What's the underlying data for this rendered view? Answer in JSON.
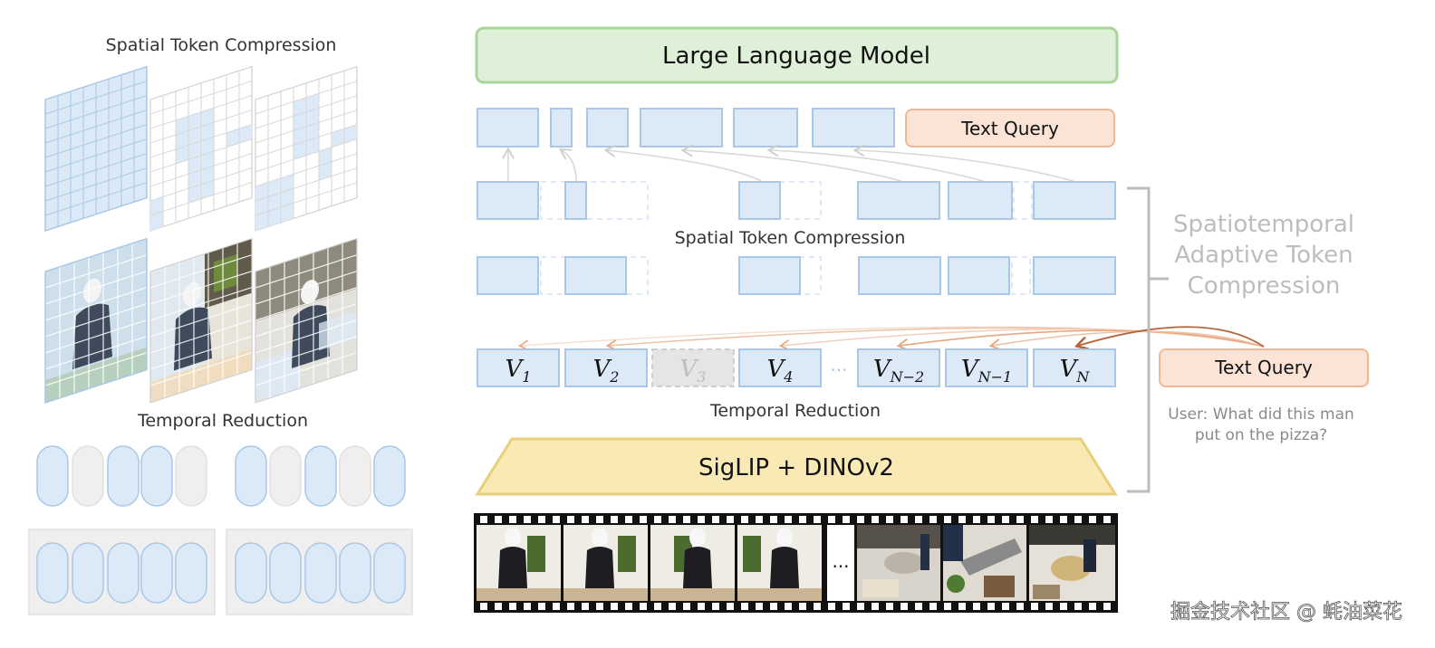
{
  "left_panel": {
    "spatial_title": "Spatial Token Compression",
    "temporal_title": "Temporal Reduction"
  },
  "main": {
    "llm_label": "Large Language Model",
    "text_query_top": "Text Query",
    "spatial_label": "Spatial Token Compression",
    "temporal_label": "Temporal Reduction",
    "encoder_label": "SigLIP + DINOv2",
    "frame_ellipsis": "...",
    "frame_tokens": [
      {
        "base": "V",
        "sub": "1"
      },
      {
        "base": "V",
        "sub": "2"
      },
      {
        "base": "V",
        "sub": "3"
      },
      {
        "base": "V",
        "sub": "4"
      },
      {
        "base": "V",
        "sub": "N−2"
      },
      {
        "base": "V",
        "sub": "N−1"
      },
      {
        "base": "V",
        "sub": "N"
      }
    ],
    "token_ellipsis": "···"
  },
  "right_panel": {
    "stc_line1": "Spatiotemporal",
    "stc_line2": "Adaptive Token",
    "stc_line3": "Compression",
    "text_query": "Text Query",
    "user_line1": "User: What did this man",
    "user_line2": "put on the pizza?"
  },
  "watermark": "掘金技术社区 @ 蚝油菜花",
  "colors": {
    "token_fill": "#dce9f7",
    "token_stroke": "#a9c8e8",
    "llm_fill": "#dff0d8",
    "llm_stroke": "#a9d59b",
    "query_fill": "#fbe3d6",
    "query_stroke": "#f0b894",
    "encoder_fill": "#f9e9b5",
    "encoder_stroke": "#e8cf7a",
    "pruned_fill": "#e5e5e5",
    "bracket": "#bdbdbd"
  }
}
